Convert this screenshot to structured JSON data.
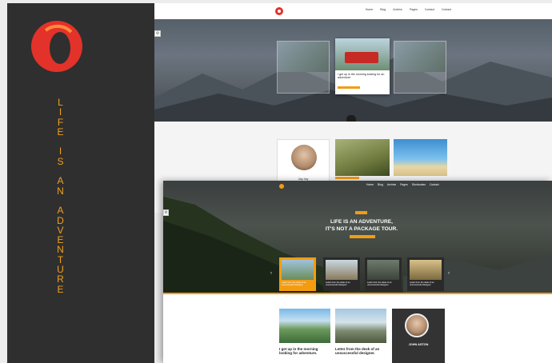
{
  "left_panel": {
    "tagline_letters": [
      "L",
      "I",
      "F",
      "E",
      "",
      "I",
      "S",
      "",
      "A",
      "N",
      "",
      "A",
      "D",
      "V",
      "E",
      "N",
      "T",
      "U",
      "R",
      "E"
    ],
    "accent": "#f0a020",
    "logo_color": "#e2322a"
  },
  "top_shot": {
    "nav": [
      "Home",
      "Blog",
      "Archive",
      "Pages",
      "Contact",
      "Contact"
    ],
    "featured_card": {
      "text": "I get up in the morning looking for an adventure."
    },
    "profile": {
      "name": "Jay Jay"
    }
  },
  "front_shot": {
    "nav": [
      "Home",
      "Blog",
      "Archive",
      "Pages",
      "Shortcodes",
      "Contact"
    ],
    "headline_line1": "LIFE IS AN ADVENTURE,",
    "headline_line2": "IT'S NOT A PACKAGE TOUR.",
    "cards": [
      {
        "text": "Letter from the desk of an unsuccessful designer"
      },
      {
        "text": "Letter from the desk of an unsuccessful designer"
      },
      {
        "text": "Letter from the desk of an unsuccessful designer"
      },
      {
        "text": "Letter from the desk of an unsuccessful designer"
      }
    ],
    "posts": [
      {
        "title": "I get up in the morning looking for adventure."
      },
      {
        "title": "Letter from the desk of an unsuccessful designer."
      }
    ],
    "author": {
      "name": "JOHN ASTON"
    },
    "accent": "#f39c12"
  }
}
